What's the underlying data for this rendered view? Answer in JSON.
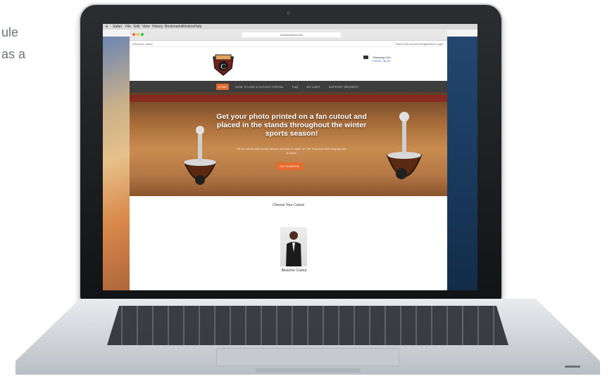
{
  "side_text": {
    "line1": "ule",
    "line2": "as a"
  },
  "mac_menubar": [
    "",
    "Safari",
    "File",
    "Edit",
    "View",
    "History",
    "Bookmarks",
    "Window",
    "Help"
  ],
  "browser": {
    "url": "crowdcutouts.com",
    "topbar_welcome": "Welcome visitor!",
    "topbar_links": "Search  My Account  Registration  Login"
  },
  "cart": {
    "title": "Shopping Cart",
    "subtitle": "0 items / $0.00"
  },
  "nav": {
    "items": [
      "HOME",
      "HOW TO USE A CUTOUT PORTAL",
      "FAQ",
      "MY CART",
      "SUPPORT REQUEST"
    ]
  },
  "hero": {
    "headline": "Get your photo printed on a fan cutout and placed in the stands throughout the winter sports season!",
    "subtext": "Fill the stands with family, friends, and pets to cheer on The Thunders while staying safe at home.",
    "button_label": "GET STARTED"
  },
  "section": {
    "choose_title": "Choose Your Cutout"
  },
  "product": {
    "label": "Bleacher Cutout"
  },
  "colors": {
    "nav_bg": "#3d3d3d",
    "accent": "#e56b2c",
    "hero_court": "#b47746"
  }
}
